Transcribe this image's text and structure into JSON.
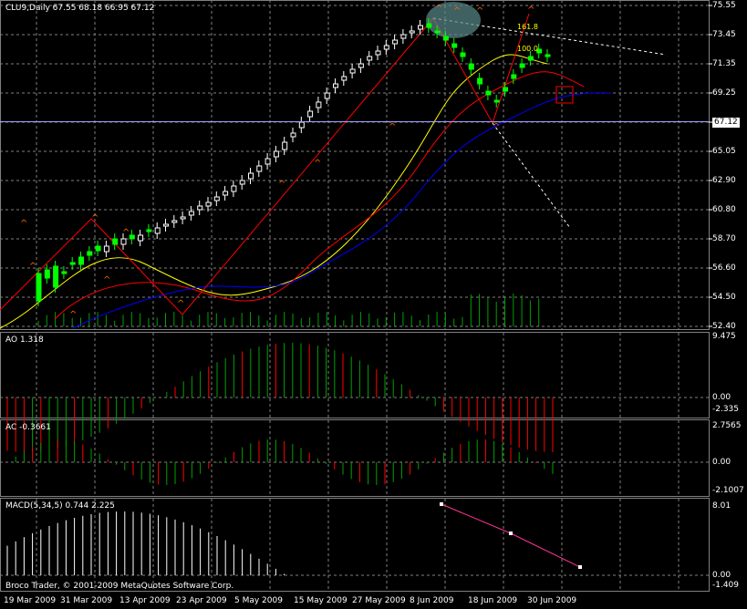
{
  "header": {
    "symbol_line": "CLU9,Daily  67.55 68.18 66.95 67.12"
  },
  "price_panel": {
    "current_price": "67.12",
    "y_ticks": [
      "75.55",
      "73.45",
      "71.35",
      "69.25",
      "67.12",
      "65.05",
      "62.90",
      "60.80",
      "58.70",
      "56.60",
      "54.50",
      "52.40"
    ],
    "fib_label": "161.8",
    "fib_label_2": "100.0"
  },
  "ao_panel": {
    "title": "AO 1.318",
    "y_ticks": [
      "9.475",
      "0.00",
      "-2.335"
    ]
  },
  "ac_panel": {
    "title": "AC -0.3661",
    "y_ticks": [
      "2.7565",
      "0.00",
      "-2.1007"
    ]
  },
  "macd_panel": {
    "title": "MACD(5,34,5) 0.744 2.225",
    "y_ticks": [
      "8.01",
      "0.00",
      "-1.409"
    ],
    "copyright": "Broco Trader, © 2001-2009 MetaQuotes Software Corp."
  },
  "x_axis": {
    "labels": [
      "19 Mar 2009",
      "31 Mar 2009",
      "13 Apr 2009",
      "23 Apr 2009",
      "5 May 2009",
      "15 May 2009",
      "27 May 2009",
      "8 Jun 2009",
      "18 Jun 2009",
      "30 Jun 2009"
    ]
  },
  "colors": {
    "bull_candle": "#00ff00",
    "bear_candle": "#ffffff",
    "ao_up": "#00a000",
    "ao_down": "#ff0000",
    "ma_fast": "#ffff00",
    "ma_mid": "#ff0000",
    "ma_slow": "#0000ff",
    "fractal": "#ff6600",
    "grid": "#808080"
  }
}
